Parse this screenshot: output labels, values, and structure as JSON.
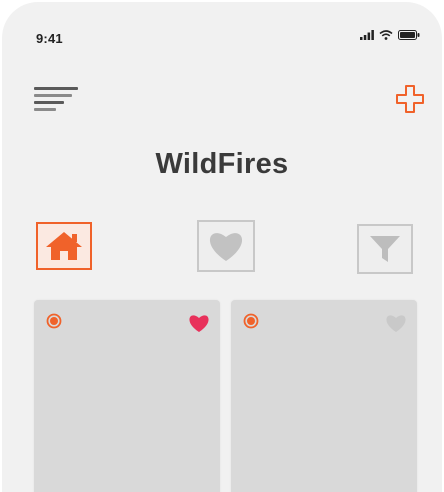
{
  "status_bar": {
    "time": "9:41",
    "icons": [
      "cellular-signal-icon",
      "wifi-icon",
      "battery-icon"
    ]
  },
  "header": {
    "menu_icon": "menu-icon",
    "add_icon": "add-icon",
    "title": "WildFires"
  },
  "tabs": [
    {
      "icon": "home-icon",
      "active": true
    },
    {
      "icon": "heart-icon",
      "active": false
    },
    {
      "icon": "filter-icon",
      "active": false
    }
  ],
  "cards": [
    {
      "status_icon": "active-fire-indicator-icon",
      "favorited": true
    },
    {
      "status_icon": "active-fire-indicator-icon",
      "favorited": false
    }
  ],
  "colors": {
    "accent": "#f0622a",
    "favorite": "#e8315b",
    "inactive_icon": "#c2c2c2",
    "background": "#f1f1f1",
    "card": "#d9d9d9",
    "title_text": "#3a3a3a"
  }
}
